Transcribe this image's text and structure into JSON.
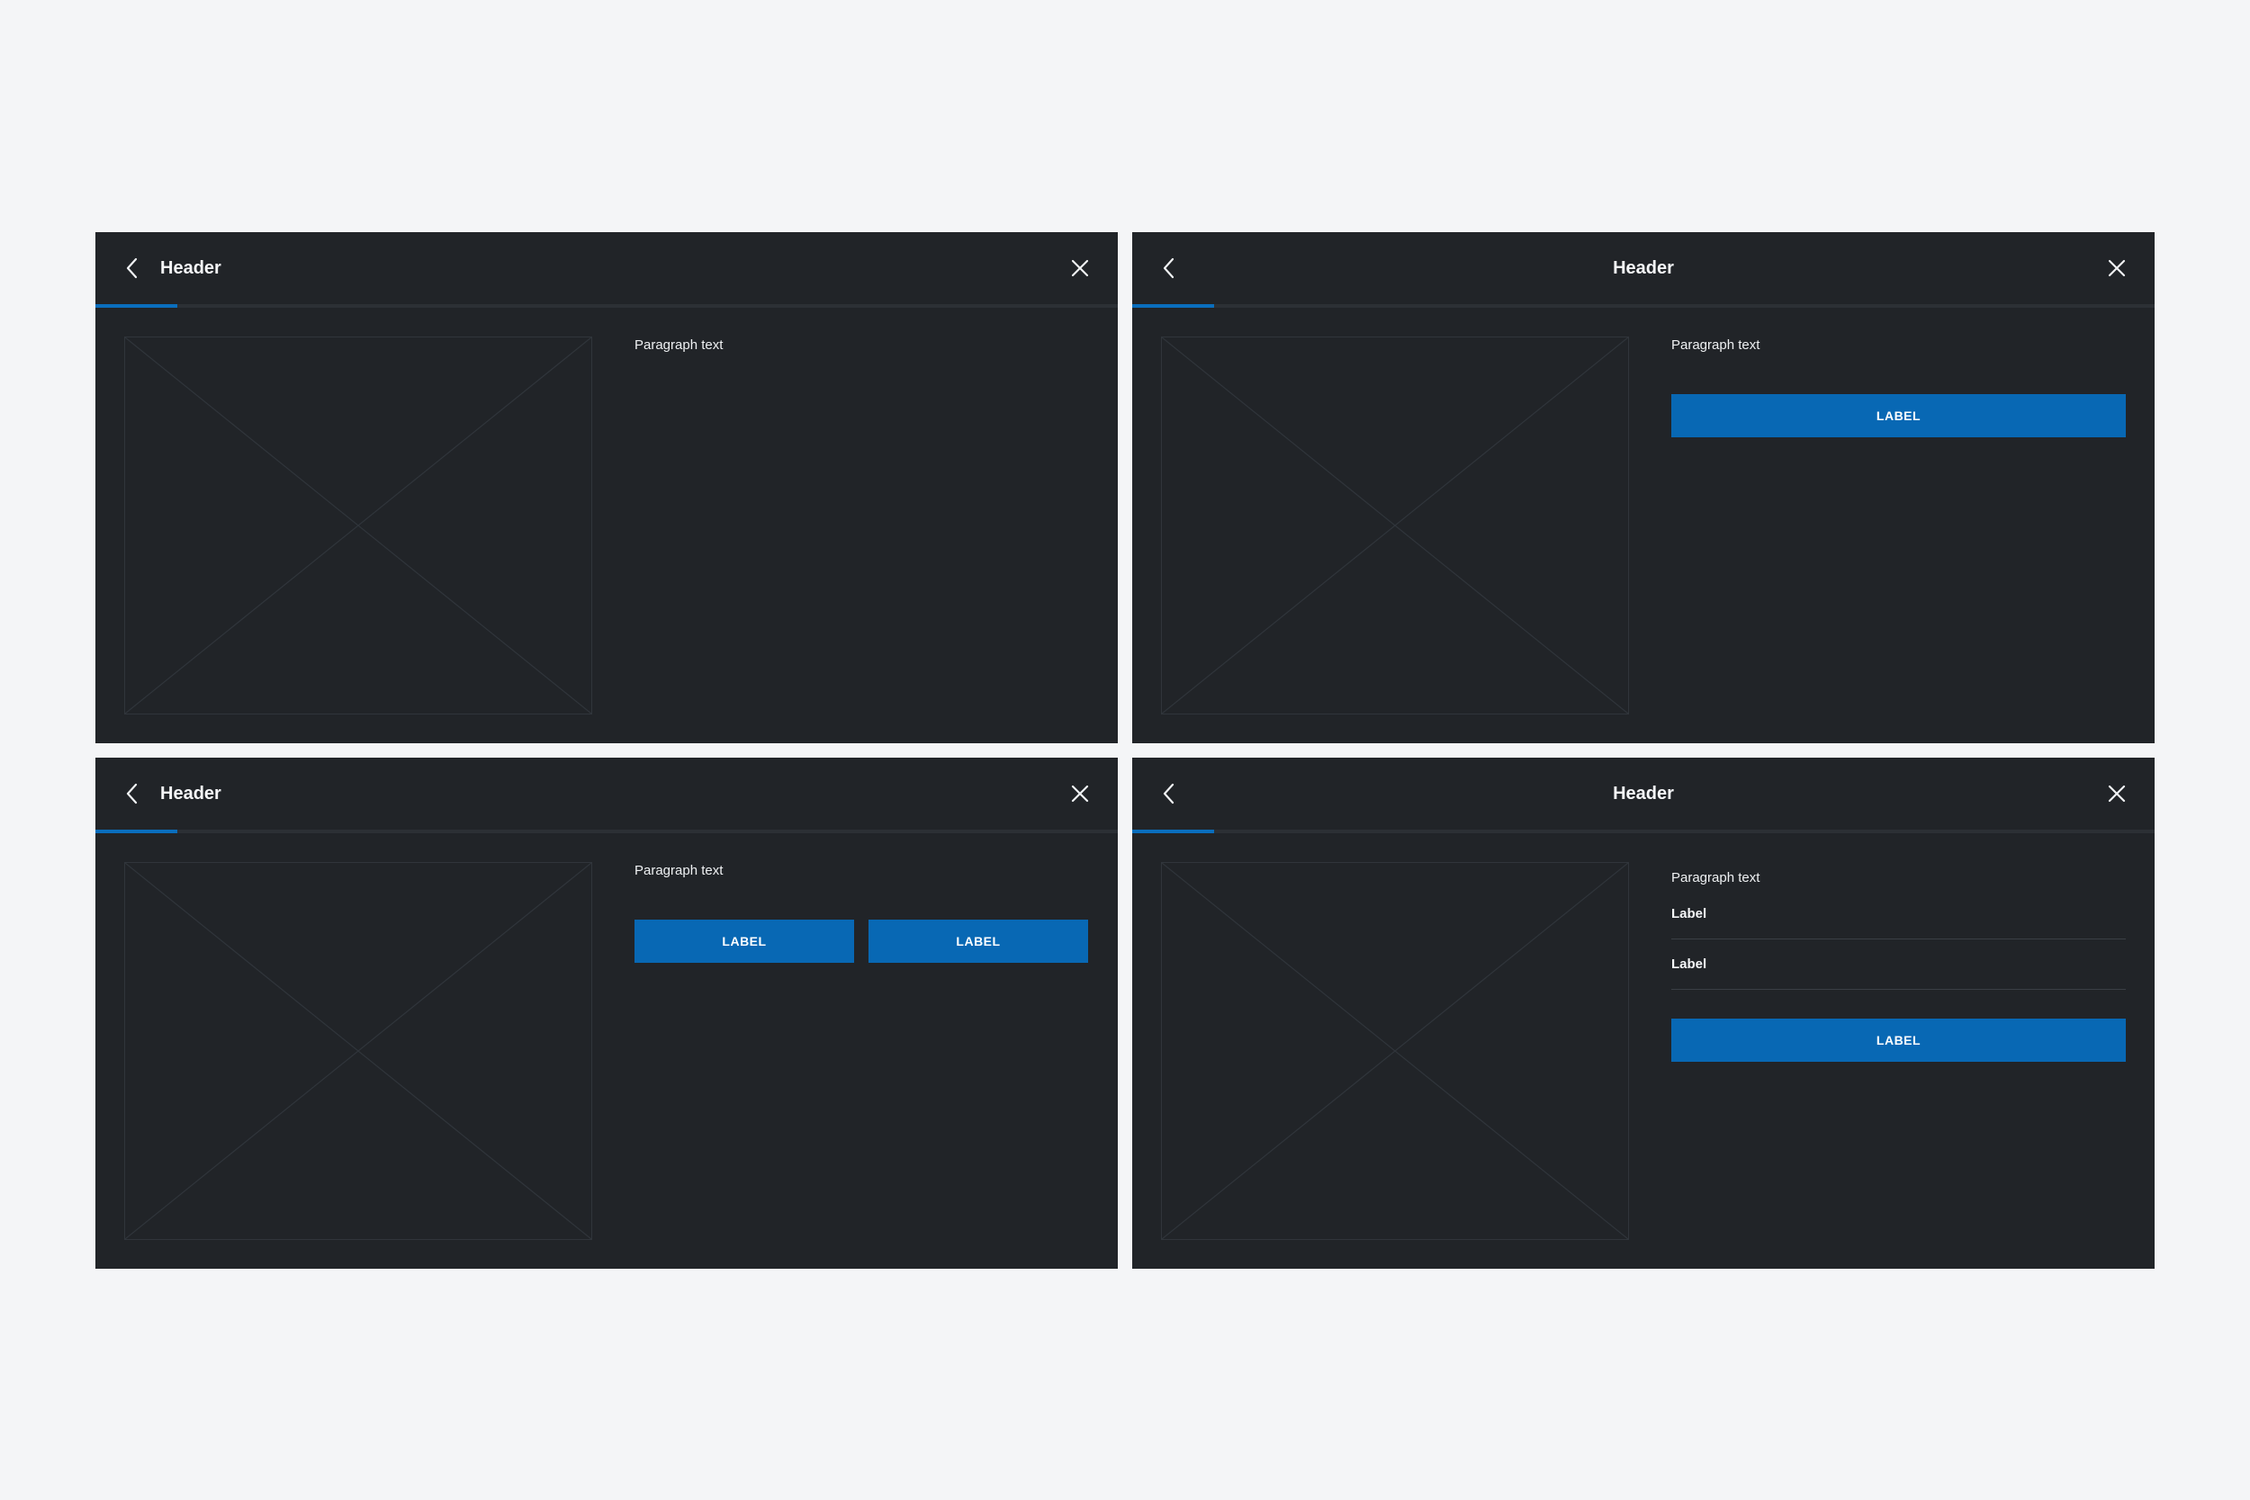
{
  "colors": {
    "page_background": "#f4f5f7",
    "panel_background": "#212428",
    "accent": "#0868b4",
    "text": "#f0f2f4"
  },
  "panels": [
    {
      "header": {
        "title": "Header",
        "title_align": "left",
        "back_icon": "chevron-left-icon",
        "close_icon": "close-icon"
      },
      "progress": {
        "fraction": 0.08
      },
      "paragraph": "Paragraph text"
    },
    {
      "header": {
        "title": "Header",
        "title_align": "center",
        "back_icon": "chevron-left-icon",
        "close_icon": "close-icon"
      },
      "progress": {
        "fraction": 0.08
      },
      "paragraph": "Paragraph text",
      "button_label": "LABEL"
    },
    {
      "header": {
        "title": "Header",
        "title_align": "left",
        "back_icon": "chevron-left-icon",
        "close_icon": "close-icon"
      },
      "progress": {
        "fraction": 0.08
      },
      "paragraph": "Paragraph text",
      "buttons": [
        "LABEL",
        "LABEL"
      ]
    },
    {
      "header": {
        "title": "Header",
        "title_align": "center",
        "back_icon": "chevron-left-icon",
        "close_icon": "close-icon"
      },
      "progress": {
        "fraction": 0.08
      },
      "paragraph": "Paragraph text",
      "list_labels": [
        "Label",
        "Label"
      ],
      "button_label": "LABEL"
    }
  ]
}
